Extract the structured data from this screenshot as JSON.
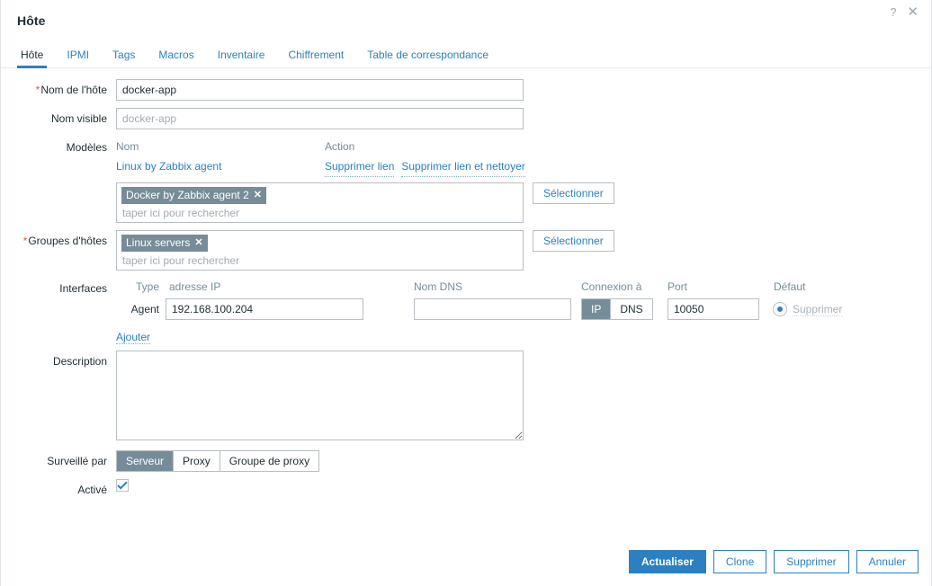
{
  "window": {
    "title": "Hôte",
    "help_icon": "question-mark-icon",
    "close_icon": "close-icon",
    "help_label": "?",
    "close_label": "✕"
  },
  "tabs": [
    {
      "label": "Hôte",
      "active": true
    },
    {
      "label": "IPMI",
      "active": false
    },
    {
      "label": "Tags",
      "active": false
    },
    {
      "label": "Macros",
      "active": false
    },
    {
      "label": "Inventaire",
      "active": false
    },
    {
      "label": "Chiffrement",
      "active": false
    },
    {
      "label": "Table de correspondance",
      "active": false
    }
  ],
  "form": {
    "host_name": {
      "label": "Nom de l'hôte",
      "required": true,
      "value": "docker-app"
    },
    "visible_name": {
      "label": "Nom visible",
      "value": "",
      "placeholder": "docker-app"
    },
    "templates": {
      "label": "Modèles",
      "col_name": "Nom",
      "col_action": "Action",
      "rows": [
        {
          "name": "Linux by Zabbix agent",
          "unlink_label": "Supprimer lien",
          "unlink_clear_label": "Supprimer lien et nettoyer"
        }
      ],
      "chips": [
        "Docker by Zabbix agent 2"
      ],
      "search_placeholder": "taper ici pour rechercher",
      "select_button": "Sélectionner"
    },
    "host_groups": {
      "label": "Groupes d'hôtes",
      "required": true,
      "chips": [
        "Linux servers"
      ],
      "search_placeholder": "taper ici pour rechercher",
      "select_button": "Sélectionner"
    },
    "interfaces": {
      "label": "Interfaces",
      "headers": {
        "type": "Type",
        "ip": "adresse IP",
        "dns": "Nom DNS",
        "connect_to": "Connexion à",
        "port": "Port",
        "default": "Défaut"
      },
      "rows": [
        {
          "type": "Agent",
          "ip": "192.168.100.204",
          "dns": "",
          "connect_options": [
            "IP",
            "DNS"
          ],
          "connect_selected": "IP",
          "port": "10050",
          "default_selected": true,
          "remove_label": "Supprimer",
          "remove_disabled": true
        }
      ],
      "add_label": "Ajouter"
    },
    "description": {
      "label": "Description",
      "value": ""
    },
    "monitored_by": {
      "label": "Surveillé par",
      "options": [
        "Serveur",
        "Proxy",
        "Groupe de proxy"
      ],
      "selected": "Serveur"
    },
    "enabled": {
      "label": "Activé",
      "checked": true
    }
  },
  "footer": {
    "buttons": [
      {
        "label": "Actualiser",
        "primary": true
      },
      {
        "label": "Clone",
        "primary": false
      },
      {
        "label": "Supprimer",
        "primary": false
      },
      {
        "label": "Annuler",
        "primary": false
      }
    ]
  },
  "colors": {
    "accent": "#2b80c2",
    "chip": "#768d99",
    "required": "#d45c4b",
    "muted": "#768d99"
  }
}
